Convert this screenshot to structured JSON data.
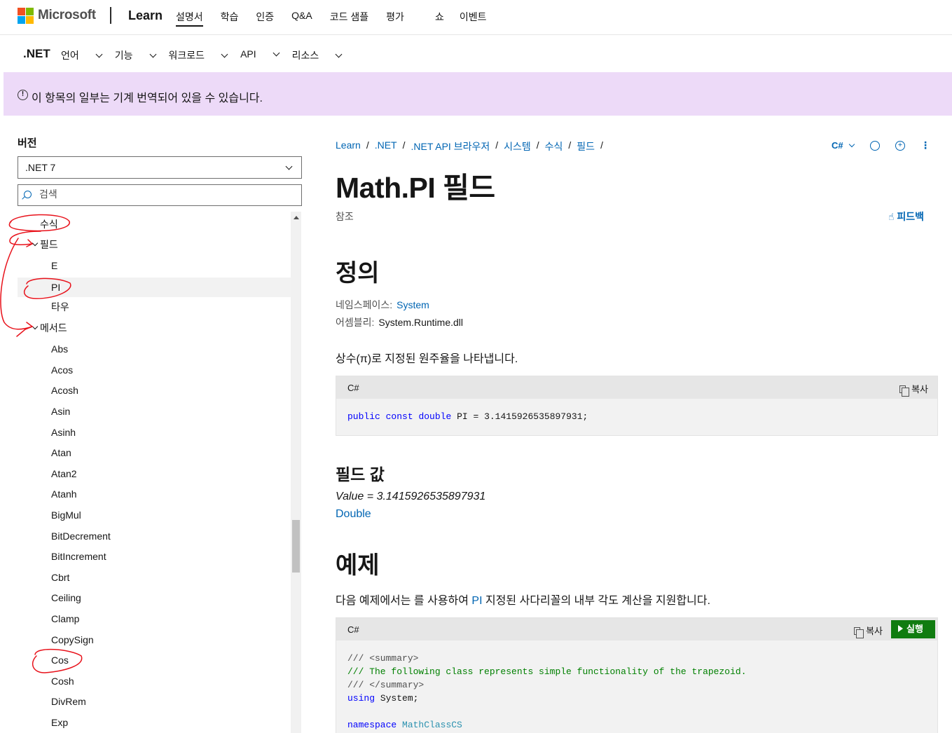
{
  "header": {
    "brand": "Microsoft",
    "site": "Learn",
    "nav": [
      "설명서",
      "학습",
      "인증",
      "Q&A",
      "코드 샘플",
      "평가",
      "쇼",
      "이벤트"
    ]
  },
  "subnav": {
    "brand": ".NET",
    "items": [
      "언어",
      "기능",
      "워크로드",
      "API",
      "리소스"
    ]
  },
  "banner": {
    "text": "이 항목의 일부는 기계 번역되어 있을 수 있습니다."
  },
  "sidebar": {
    "version_label": "버전",
    "version_value": ".NET 7",
    "search_placeholder": "검색",
    "toc": [
      {
        "label": "수식",
        "indent": 1,
        "chevron": false
      },
      {
        "label": "필드",
        "indent": 1,
        "chevron": true
      },
      {
        "label": "E",
        "indent": 2,
        "chevron": false
      },
      {
        "label": "PI",
        "indent": 2,
        "chevron": false,
        "selected": true
      },
      {
        "label": "타우",
        "indent": 2,
        "chevron": false
      },
      {
        "label": "메서드",
        "indent": 1,
        "chevron": true
      },
      {
        "label": "Abs",
        "indent": 2
      },
      {
        "label": "Acos",
        "indent": 2
      },
      {
        "label": "Acosh",
        "indent": 2
      },
      {
        "label": "Asin",
        "indent": 2
      },
      {
        "label": "Asinh",
        "indent": 2
      },
      {
        "label": "Atan",
        "indent": 2
      },
      {
        "label": "Atan2",
        "indent": 2
      },
      {
        "label": "Atanh",
        "indent": 2
      },
      {
        "label": "BigMul",
        "indent": 2
      },
      {
        "label": "BitDecrement",
        "indent": 2
      },
      {
        "label": "BitIncrement",
        "indent": 2
      },
      {
        "label": "Cbrt",
        "indent": 2
      },
      {
        "label": "Ceiling",
        "indent": 2
      },
      {
        "label": "Clamp",
        "indent": 2
      },
      {
        "label": "CopySign",
        "indent": 2
      },
      {
        "label": "Cos",
        "indent": 2
      },
      {
        "label": "Cosh",
        "indent": 2
      },
      {
        "label": "DivRem",
        "indent": 2
      },
      {
        "label": "Exp",
        "indent": 2
      }
    ]
  },
  "breadcrumb": [
    "Learn",
    ".NET",
    ".NET API 브라우저",
    "시스템",
    "수식",
    "필드"
  ],
  "toolbar": {
    "language": "C#"
  },
  "page": {
    "title": "Math.PI 필드",
    "reference": "참조",
    "feedback": "피드백",
    "definition_heading": "정의",
    "namespace_label": "네임스페이스:",
    "namespace_value": "System",
    "assembly_label": "어셈블리:",
    "assembly_value": "System.Runtime.dll",
    "summary": "상수(π)로 지정된 원주율을 나타냅니다.",
    "code1_lang": "C#",
    "copy_label": "복사",
    "code1_parts": {
      "k1": "public",
      "k2": "const",
      "k3": "double",
      "rest": " PI = 3.1415926535897931;"
    },
    "field_value_heading": "필드 값",
    "field_value": "Value = 3.1415926535897931",
    "field_type": "Double",
    "example_heading": "예제",
    "example_text_pre": "다음 예제에서는 를 사용하여 ",
    "example_link": "PI",
    "example_text_post": " 지정된 사다리꼴의 내부 각도 계산을 지원합니다.",
    "code2_lang": "C#",
    "run_label": "실행",
    "code2_parts": {
      "l1": "/// <summary>",
      "l2": "/// The following class represents simple functionality of the trapezoid.",
      "l3": "/// </summary>",
      "l4_kw": "using",
      "l4_rest": " System;",
      "l6_kw": "namespace",
      "l6_ty": "MathClassCS"
    }
  }
}
